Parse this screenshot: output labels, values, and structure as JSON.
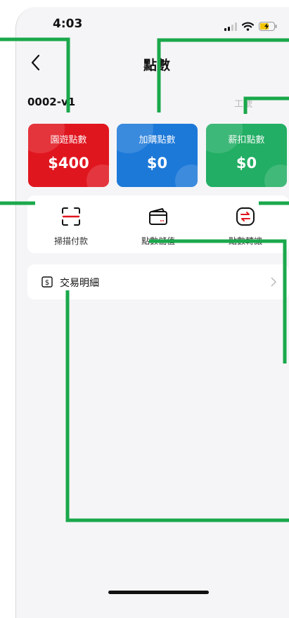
{
  "status_bar": {
    "time": "4:03"
  },
  "nav": {
    "title": "點數"
  },
  "account": {
    "id": "0002-‍v1",
    "employee_label": "工號"
  },
  "cards": [
    {
      "title": "園遊點數",
      "value": "$400"
    },
    {
      "title": "加購點數",
      "value": "$0"
    },
    {
      "title": "薪扣點數",
      "value": "$0"
    }
  ],
  "actions": [
    {
      "label": "掃描付款"
    },
    {
      "label": "點數儲值"
    },
    {
      "label": "點數轉讓"
    }
  ],
  "transactions": {
    "label": "交易明細"
  },
  "colors": {
    "red_card": "#e0161f",
    "blue_card": "#1d79d8",
    "green_card": "#22ae64",
    "annotation_line": "#1aa84b"
  },
  "icons": {
    "back": "chevron-left-icon",
    "scan": "scan-icon",
    "topup": "wallet-icon",
    "transfer": "transfer-icon",
    "transactions": "dollar-receipt-icon",
    "row_chevron": "chevron-right-icon"
  }
}
